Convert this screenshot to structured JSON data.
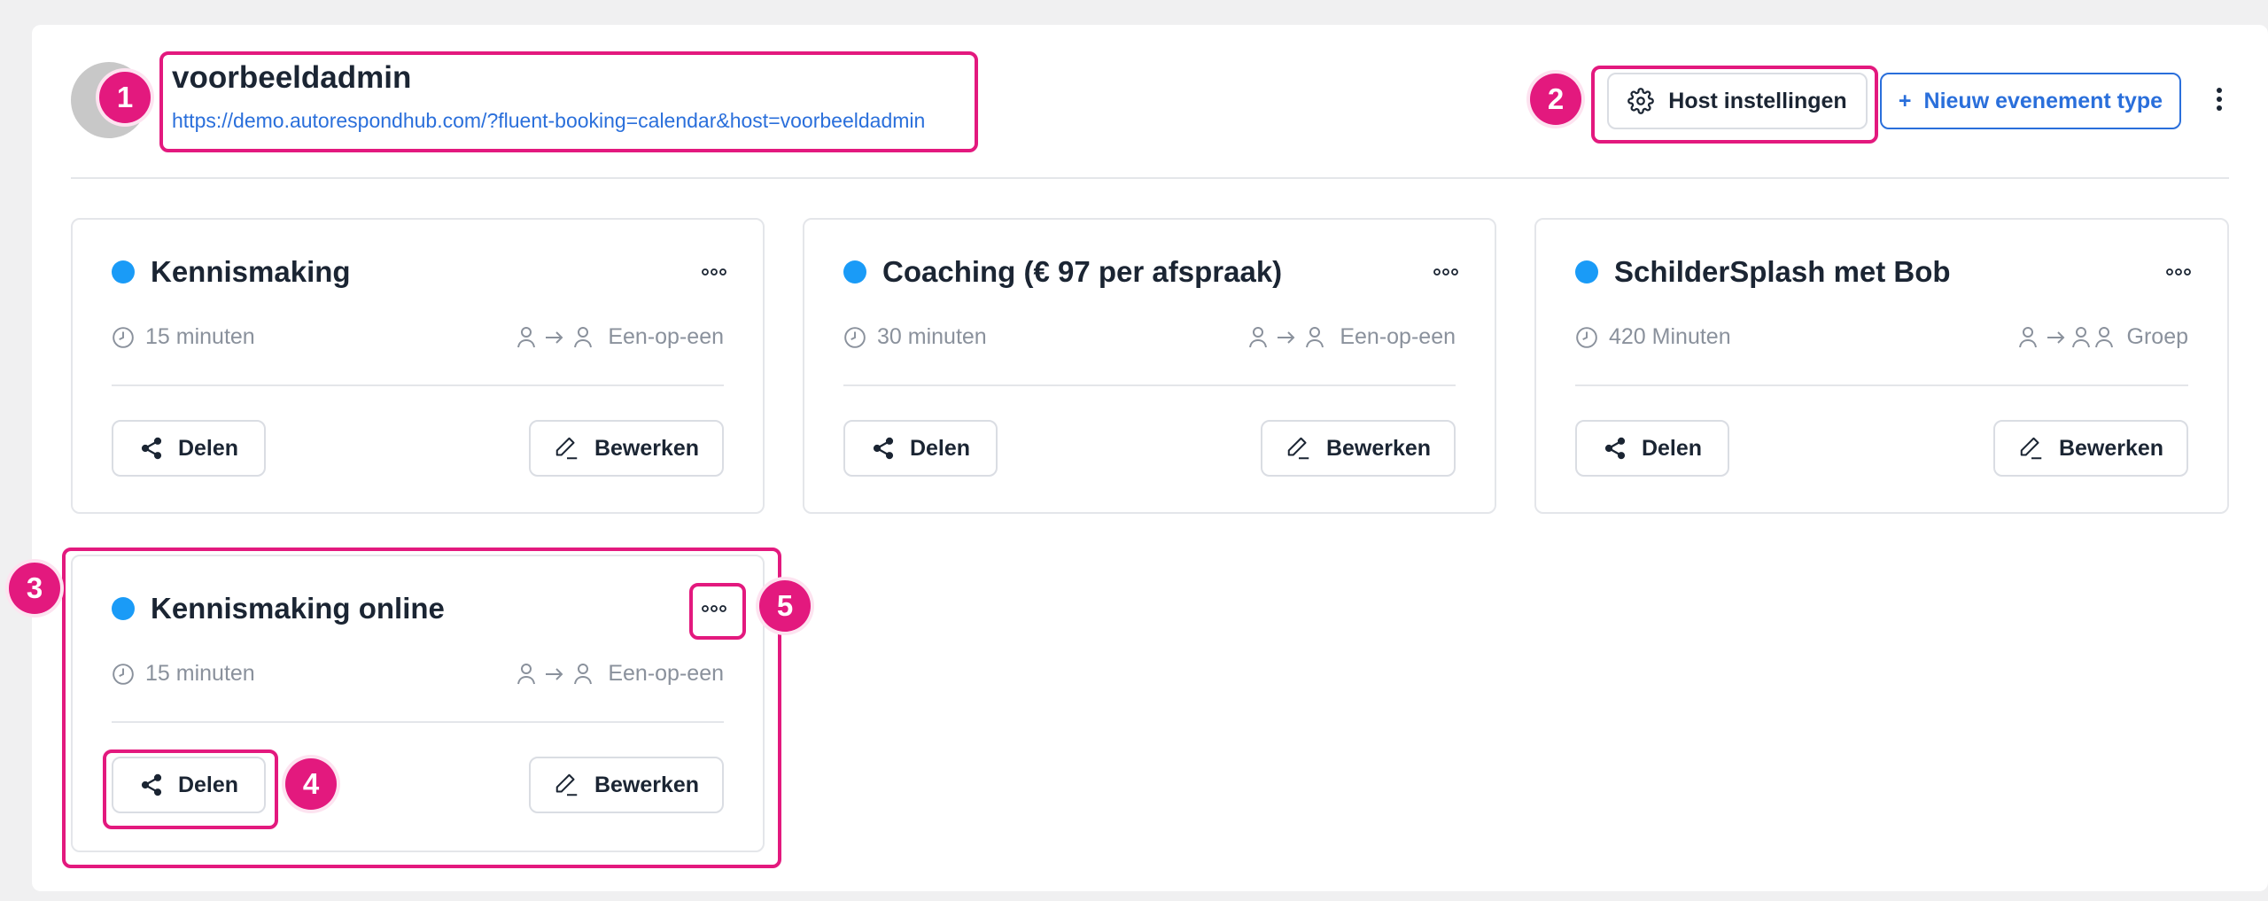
{
  "host": {
    "name": "voorbeeldadmin",
    "url": "https://demo.autorespondhub.com/?fluent-booking=calendar&host=voorbeeldadmin"
  },
  "header": {
    "settings_label": "Host instellingen",
    "new_event_label": "Nieuw evenement type",
    "new_event_plus": "+"
  },
  "cards": [
    {
      "title": "Kennismaking",
      "duration": "15 minuten",
      "type": "Een-op-een",
      "share_label": "Delen",
      "edit_label": "Bewerken"
    },
    {
      "title": "Coaching (€ 97 per afspraak)",
      "duration": "30 minuten",
      "type": "Een-op-een",
      "share_label": "Delen",
      "edit_label": "Bewerken"
    },
    {
      "title": "SchilderSplash met Bob",
      "duration": "420 Minuten",
      "type": "Groep",
      "share_label": "Delen",
      "edit_label": "Bewerken"
    },
    {
      "title": "Kennismaking online",
      "duration": "15 minuten",
      "type": "Een-op-een",
      "share_label": "Delen",
      "edit_label": "Bewerken"
    }
  ],
  "annotations": [
    "1",
    "2",
    "3",
    "4",
    "5"
  ],
  "colors": {
    "accent": "#2a6fdb",
    "status_dot": "#1a9bf7",
    "highlight": "#e3197e"
  },
  "icons": [
    "clock-icon",
    "user-to-user-icon",
    "user-to-group-icon",
    "share-icon",
    "edit-icon",
    "gear-icon",
    "more-horizontal-icon",
    "more-vertical-icon"
  ]
}
